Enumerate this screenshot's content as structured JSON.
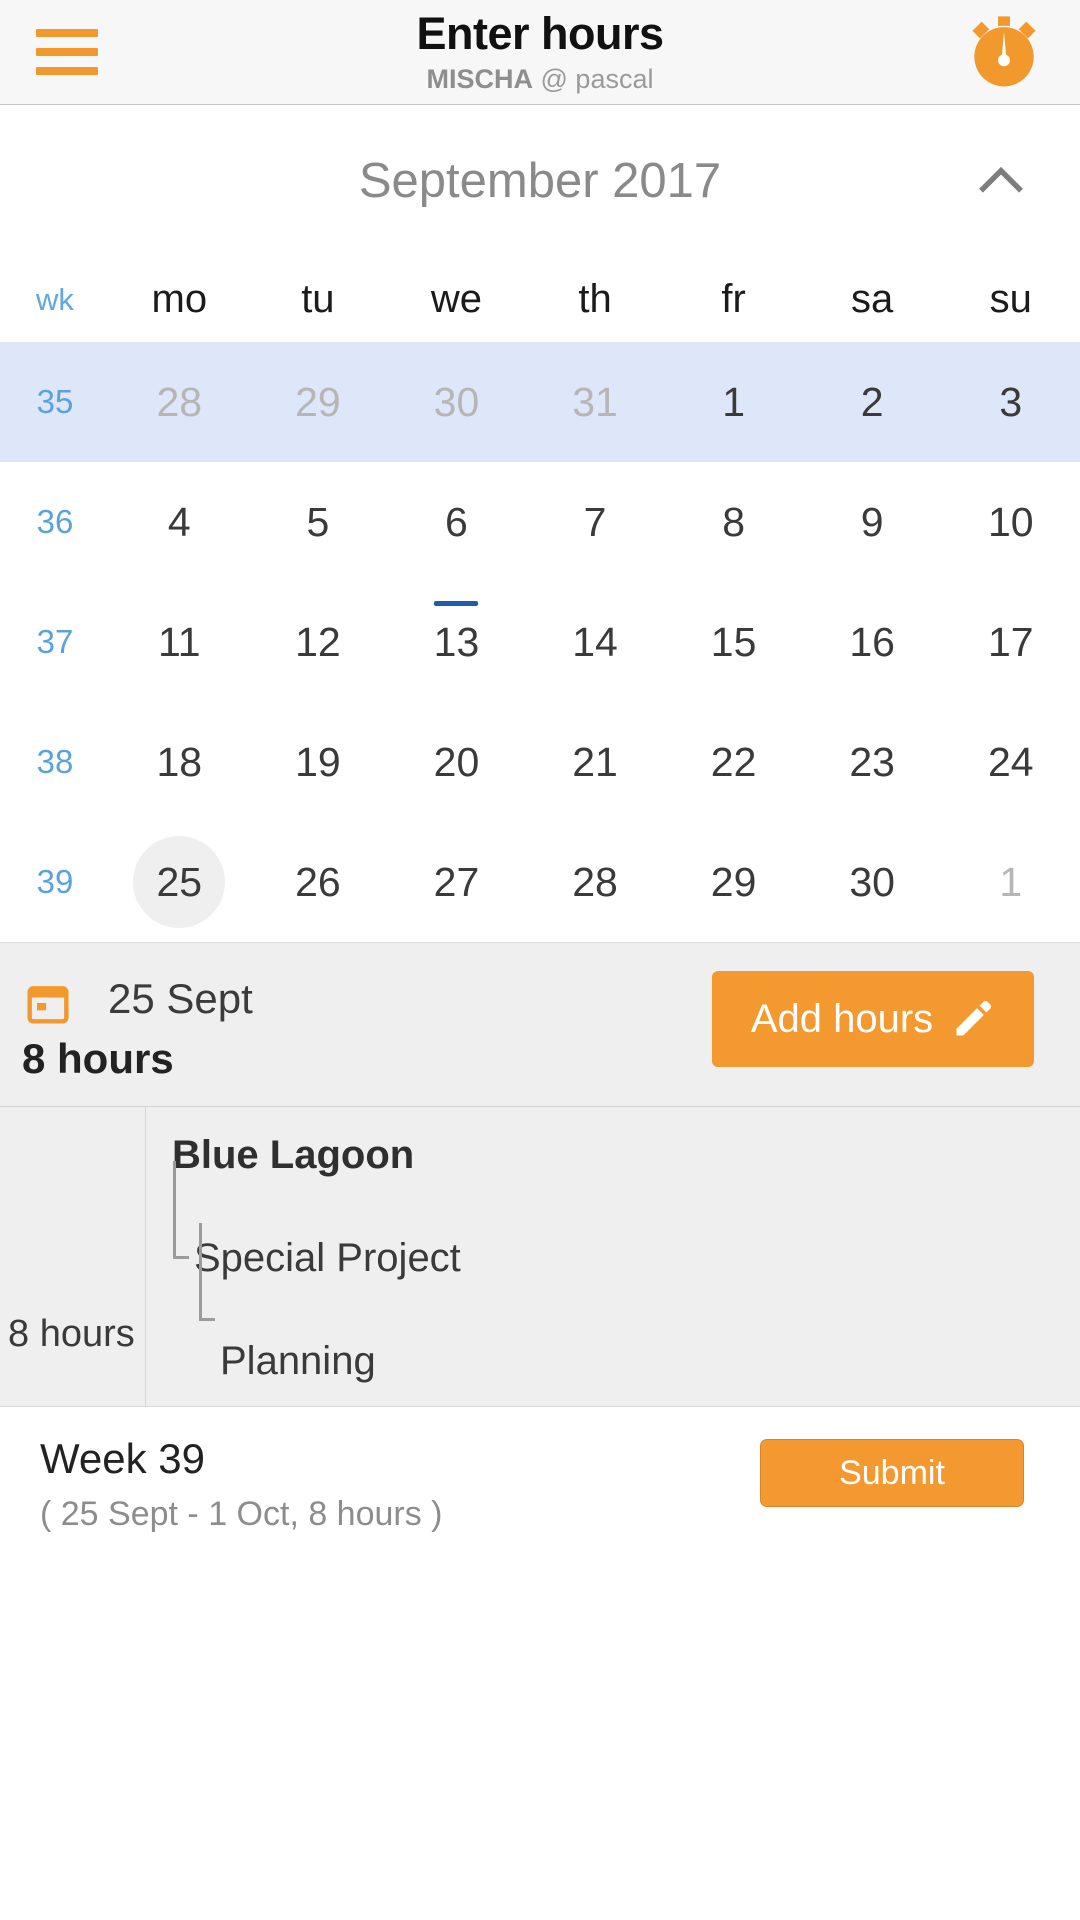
{
  "header": {
    "menu_icon": "hamburger-icon",
    "title": "Enter hours",
    "subtitle_user": "MISCHA",
    "subtitle_rest": " @ pascal",
    "timer_icon": "stopwatch-icon",
    "accent": "#f2992e"
  },
  "calendar": {
    "month_label": "September 2017",
    "collapse_icon": "chevron-up-icon",
    "dow": [
      "wk",
      "mo",
      "tu",
      "we",
      "th",
      "fr",
      "sa",
      "su"
    ],
    "highlight_color": "#dde7f9",
    "marker_color": "#1c5fa8",
    "weeks": [
      {
        "wk": "35",
        "highlight": true,
        "days": [
          {
            "n": "28",
            "muted": true
          },
          {
            "n": "29",
            "muted": true
          },
          {
            "n": "30",
            "muted": true
          },
          {
            "n": "31",
            "muted": true
          },
          {
            "n": "1",
            "muted": false
          },
          {
            "n": "2",
            "muted": false
          },
          {
            "n": "3",
            "muted": false
          }
        ]
      },
      {
        "wk": "36",
        "highlight": false,
        "days": [
          {
            "n": "4",
            "muted": false
          },
          {
            "n": "5",
            "muted": false
          },
          {
            "n": "6",
            "muted": false,
            "dash": true
          },
          {
            "n": "7",
            "muted": false
          },
          {
            "n": "8",
            "muted": false
          },
          {
            "n": "9",
            "muted": false
          },
          {
            "n": "10",
            "muted": false
          }
        ]
      },
      {
        "wk": "37",
        "highlight": false,
        "days": [
          {
            "n": "11",
            "muted": false
          },
          {
            "n": "12",
            "muted": false
          },
          {
            "n": "13",
            "muted": false
          },
          {
            "n": "14",
            "muted": false
          },
          {
            "n": "15",
            "muted": false
          },
          {
            "n": "16",
            "muted": false
          },
          {
            "n": "17",
            "muted": false
          }
        ]
      },
      {
        "wk": "38",
        "highlight": false,
        "days": [
          {
            "n": "18",
            "muted": false
          },
          {
            "n": "19",
            "muted": false
          },
          {
            "n": "20",
            "muted": false
          },
          {
            "n": "21",
            "muted": false
          },
          {
            "n": "22",
            "muted": false
          },
          {
            "n": "23",
            "muted": false
          },
          {
            "n": "24",
            "muted": false
          }
        ]
      },
      {
        "wk": "39",
        "highlight": false,
        "days": [
          {
            "n": "25",
            "muted": false,
            "selected": true,
            "underline": true
          },
          {
            "n": "26",
            "muted": false
          },
          {
            "n": "27",
            "muted": false
          },
          {
            "n": "28",
            "muted": false
          },
          {
            "n": "29",
            "muted": false
          },
          {
            "n": "30",
            "muted": false
          },
          {
            "n": "1",
            "muted": true
          }
        ]
      }
    ]
  },
  "day_summary": {
    "calendar_icon": "calendar-icon",
    "date": "25 Sept",
    "hours": "8 hours",
    "add_hours_label": "Add hours",
    "add_hours_icon": "pencil-icon",
    "button_color": "#f4992f"
  },
  "entries": [
    {
      "hours": "8 hours",
      "tree": [
        "Blue Lagoon",
        "Special Project",
        "Planning"
      ]
    }
  ],
  "footer": {
    "week_title": "Week 39",
    "week_range": "( 25 Sept - 1 Oct, 8 hours )",
    "submit_label": "Submit"
  }
}
